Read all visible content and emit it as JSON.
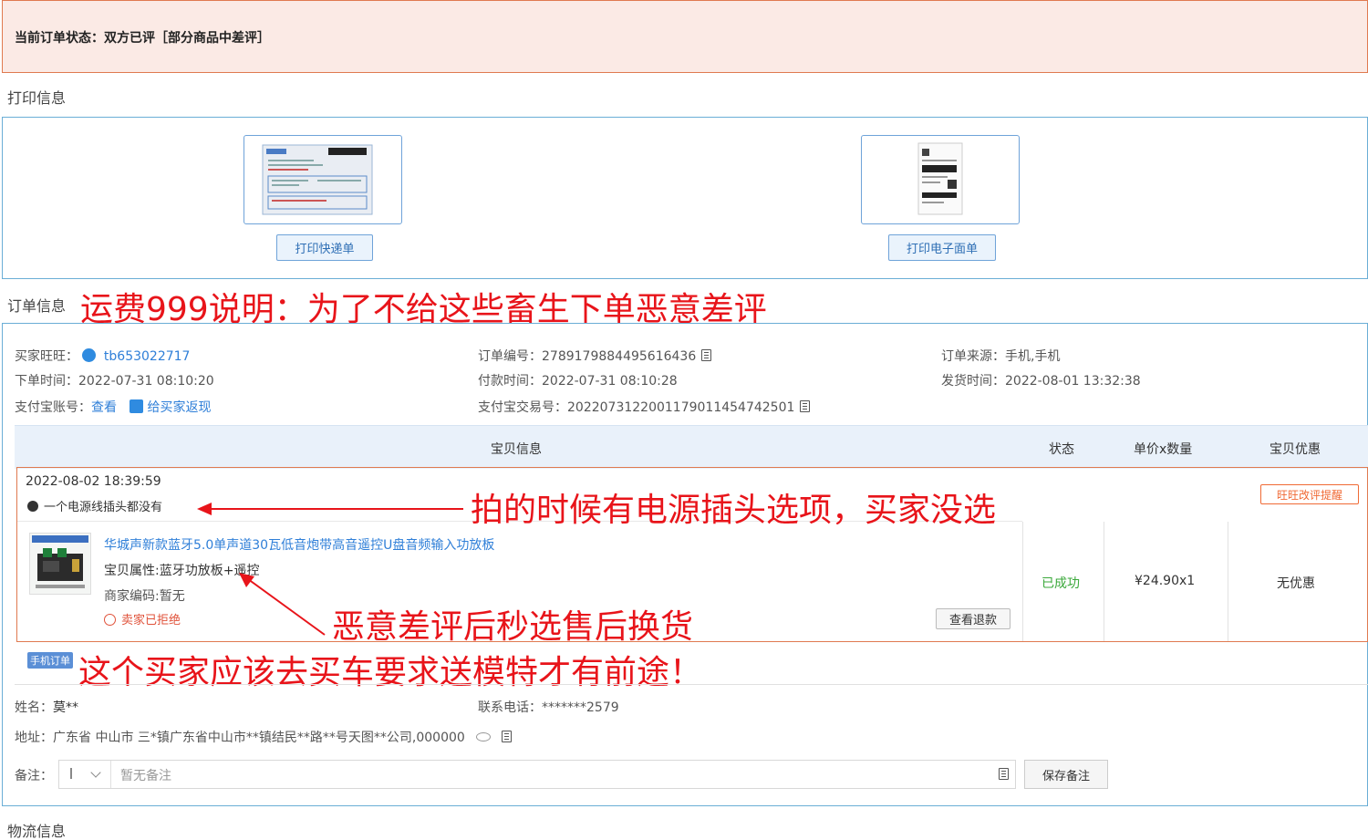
{
  "status": {
    "text": "当前订单状态：双方已评［部分商品中差评］"
  },
  "sections": {
    "print_title": "打印信息",
    "order_title": "订单信息",
    "logistics_title": "物流信息"
  },
  "print": {
    "express_button": "打印快递单",
    "electronic_button": "打印电子面单"
  },
  "order": {
    "buyer_label": "买家旺旺：",
    "buyer_id": "tb653022717",
    "order_time_label": "下单时间：",
    "order_time": "2022-07-31 08:10:20",
    "alipay_label": "支付宝账号：",
    "alipay_view": "查看",
    "cashback": "给买家返现",
    "order_no_label": "订单编号：",
    "order_no": "2789179884495616436",
    "pay_time_label": "付款时间：",
    "pay_time": "2022-07-31 08:10:28",
    "trade_no_label": "支付宝交易号：",
    "trade_no": "2022073122001179011454742501",
    "source_label": "订单来源：",
    "source": "手机,手机",
    "ship_time_label": "发货时间：",
    "ship_time": "2022-08-01 13:32:38"
  },
  "table": {
    "headers": [
      "宝贝信息",
      "状态",
      "单价x数量",
      "宝贝优惠"
    ]
  },
  "review": {
    "date": "2022-08-02 18:39:59",
    "comment": "一个电源线插头都没有",
    "wangwang_button": "旺旺改评提醒"
  },
  "item": {
    "title": "华城声新款蓝牙5.0单声道30瓦低音炮带高音遥控U盘音频输入功放板",
    "attr": "宝贝属性:蓝牙功放板+遥控",
    "code": "商家编码:暂无",
    "refund_status": "卖家已拒绝",
    "view_refund": "查看退款",
    "status": "已成功",
    "price_qty": "¥24.90x1",
    "discount": "无优惠"
  },
  "annotations": {
    "note1": "运费999说明：为了不给这些畜生下单恶意差评",
    "note2": "拍的时候有电源插头选项，买家没选",
    "note3": "恶意差评后秒选售后换货",
    "note4": "这个买家应该去买车要求送模特才有前途！"
  },
  "mobile_badge": "手机订单",
  "receiver": {
    "name_label": "姓名：",
    "name": "莫**",
    "phone_label": "联系电话：",
    "phone": "*******2579",
    "address_label": "地址：",
    "address": "广东省 中山市 三*镇广东省中山市**镇结民**路**号天图**公司,000000"
  },
  "remark": {
    "label": "备注：",
    "placeholder": "暂无备注",
    "save_button": "保存备注"
  },
  "colors": {
    "annotation_red": "#e8141a",
    "link_blue": "#2f7fd8",
    "success_green": "#3aa83a",
    "alert_orange": "#f06a35"
  }
}
